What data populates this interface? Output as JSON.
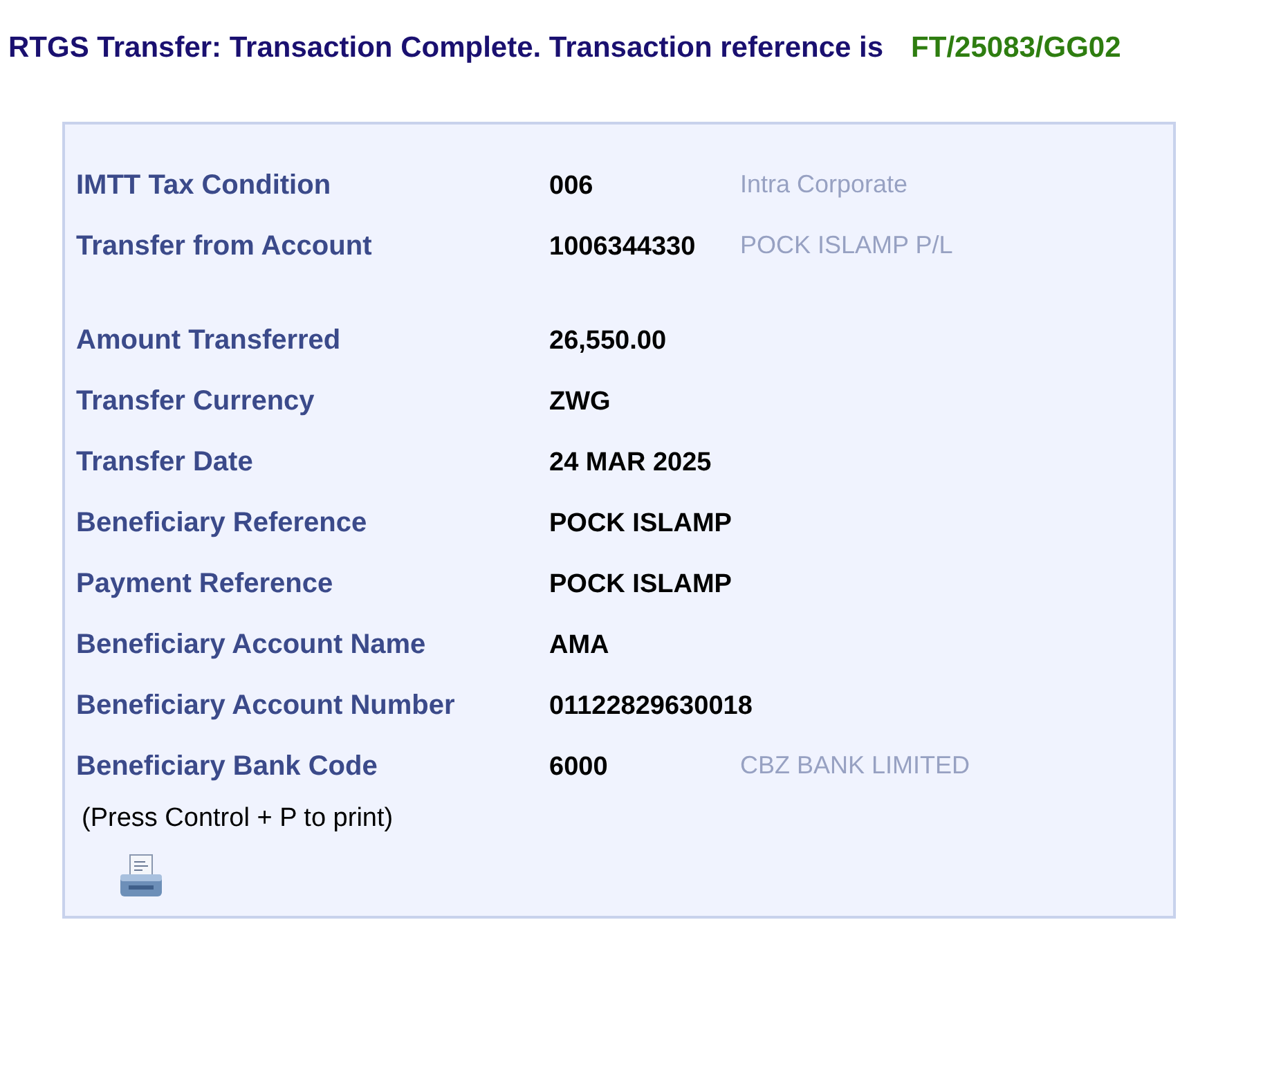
{
  "header": {
    "message": "RTGS Transfer: Transaction Complete. Transaction reference is",
    "reference": "FT/25083/GG02"
  },
  "details": [
    {
      "label": "IMTT Tax Condition",
      "value": "006",
      "note": "Intra Corporate"
    },
    {
      "label": "Transfer from Account",
      "value": "1006344330",
      "note": "POCK ISLAMP P/L"
    },
    {
      "label": "Amount Transferred",
      "value": "26,550.00"
    },
    {
      "label": "Transfer Currency",
      "value": "ZWG"
    },
    {
      "label": "Transfer Date",
      "value": "24 MAR 2025"
    },
    {
      "label": "Beneficiary Reference",
      "value": "POCK ISLAMP"
    },
    {
      "label": "Payment Reference",
      "value": "POCK ISLAMP"
    },
    {
      "label": "Beneficiary Account Name",
      "value": "AMA"
    },
    {
      "label": "Beneficiary Account Number",
      "value": "01122829630018"
    },
    {
      "label": "Beneficiary Bank Code",
      "value": "6000",
      "note": "CBZ BANK LIMITED"
    }
  ],
  "print_hint": "(Press Control + P to print)"
}
